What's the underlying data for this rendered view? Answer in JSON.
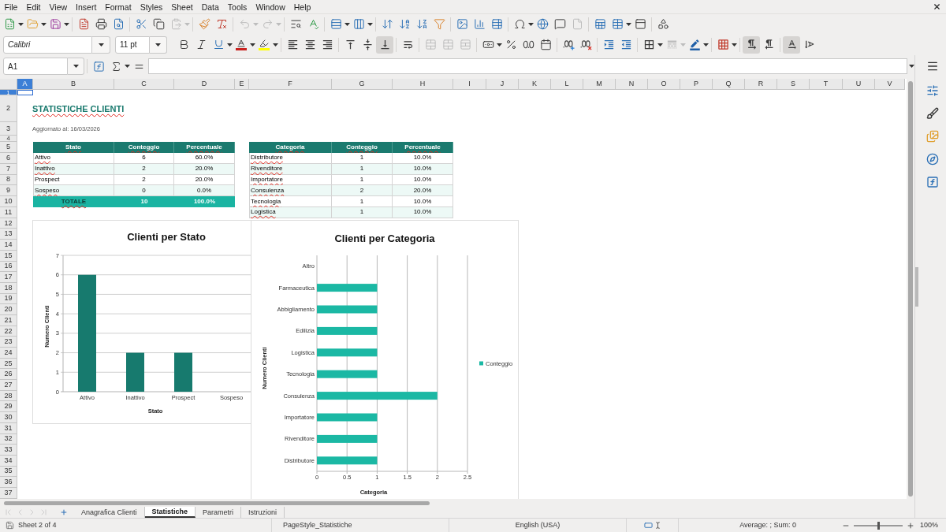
{
  "menu_bar": [
    "File",
    "Edit",
    "View",
    "Insert",
    "Format",
    "Styles",
    "Sheet",
    "Data",
    "Tools",
    "Window",
    "Help"
  ],
  "standard_toolbar": {
    "paste": {
      "disabled": true
    },
    "undo": {
      "disabled": true
    },
    "redo": {
      "disabled": true
    },
    "header_footer": {
      "disabled": true
    }
  },
  "format_toolbar": {
    "font_name": "Calibri",
    "font_size": "11 pt",
    "vertical_align": [
      {
        "selected": false
      },
      {
        "selected": false
      },
      {
        "selected": true
      }
    ],
    "merge_cells": [
      {
        "disabled": true
      },
      {
        "disabled": true
      },
      {
        "disabled": true
      }
    ],
    "border_style": {
      "disabled": true
    },
    "paragraph_direction": [
      {
        "selected": true
      },
      {
        "selected": false
      }
    ],
    "text_direction": [
      {
        "selected": true
      },
      {
        "selected": false
      }
    ]
  },
  "formula_bar": {
    "name_box": "A1"
  },
  "sheet": {
    "columns": [
      {
        "label": "A",
        "selected": true
      },
      {
        "label": "B",
        "selected": false
      },
      {
        "label": "C",
        "selected": false
      },
      {
        "label": "D",
        "selected": false
      },
      {
        "label": "E",
        "selected": false
      },
      {
        "label": "F",
        "selected": false
      },
      {
        "label": "G",
        "selected": false
      },
      {
        "label": "H",
        "selected": false
      },
      {
        "label": "I",
        "selected": false
      },
      {
        "label": "J",
        "selected": false
      },
      {
        "label": "K",
        "selected": false
      },
      {
        "label": "L",
        "selected": false
      },
      {
        "label": "M",
        "selected": false
      },
      {
        "label": "N",
        "selected": false
      },
      {
        "label": "O",
        "selected": false
      },
      {
        "label": "P",
        "selected": false
      },
      {
        "label": "Q",
        "selected": false
      },
      {
        "label": "R",
        "selected": false
      },
      {
        "label": "S",
        "selected": false
      },
      {
        "label": "T",
        "selected": false
      },
      {
        "label": "U",
        "selected": false
      },
      {
        "label": "V",
        "selected": false
      }
    ],
    "rows": [
      {
        "label": "1",
        "selected": true
      },
      {
        "label": "2",
        "selected": false
      },
      {
        "label": "3",
        "selected": false
      },
      {
        "label": "4",
        "selected": false
      },
      {
        "label": "5",
        "selected": false
      },
      {
        "label": "6",
        "selected": false
      },
      {
        "label": "7",
        "selected": false
      },
      {
        "label": "8",
        "selected": false
      },
      {
        "label": "9",
        "selected": false
      },
      {
        "label": "10",
        "selected": false
      },
      {
        "label": "11",
        "selected": false
      },
      {
        "label": "12",
        "selected": false
      },
      {
        "label": "13",
        "selected": false
      },
      {
        "label": "14",
        "selected": false
      },
      {
        "label": "15",
        "selected": false
      },
      {
        "label": "16",
        "selected": false
      },
      {
        "label": "17",
        "selected": false
      },
      {
        "label": "18",
        "selected": false
      },
      {
        "label": "19",
        "selected": false
      },
      {
        "label": "20",
        "selected": false
      },
      {
        "label": "21",
        "selected": false
      },
      {
        "label": "22",
        "selected": false
      },
      {
        "label": "23",
        "selected": false
      },
      {
        "label": "24",
        "selected": false
      },
      {
        "label": "25",
        "selected": false
      },
      {
        "label": "26",
        "selected": false
      },
      {
        "label": "27",
        "selected": false
      },
      {
        "label": "28",
        "selected": false
      },
      {
        "label": "29",
        "selected": false
      },
      {
        "label": "30",
        "selected": false
      },
      {
        "label": "31",
        "selected": false
      },
      {
        "label": "32",
        "selected": false
      },
      {
        "label": "33",
        "selected": false
      },
      {
        "label": "34",
        "selected": false
      },
      {
        "label": "35",
        "selected": false
      },
      {
        "label": "36",
        "selected": false
      },
      {
        "label": "37",
        "selected": false
      }
    ],
    "title": {
      "text": "STATISTICHE CLIENTI",
      "misspelled": true
    },
    "updated": {
      "text": "Aggiornato al: 16/03/2026"
    },
    "tables": [
      {
        "header": {
          "cells": [
            "Stato",
            "Conteggio",
            "Percentuale"
          ],
          "misspelled": true
        },
        "rows": [
          {
            "kind": "data",
            "label": "Attivo",
            "misspelled": true,
            "count": "6",
            "percent": "60.0%"
          },
          {
            "kind": "data",
            "label": "Inattivo",
            "misspelled": true,
            "count": "2",
            "percent": "20.0%"
          },
          {
            "kind": "data",
            "label": "Prospect",
            "misspelled": false,
            "count": "2",
            "percent": "20.0%"
          },
          {
            "kind": "data",
            "label": "Sospeso",
            "misspelled": true,
            "count": "0",
            "percent": "0.0%"
          },
          {
            "kind": "total",
            "label": "TOTALE",
            "misspelled": true,
            "count": "10",
            "percent": "100.0%"
          }
        ]
      },
      {
        "header": {
          "cells": [
            "Categoria",
            "Conteggio",
            "Percentuale"
          ],
          "misspelled": true
        },
        "rows": [
          {
            "kind": "data",
            "label": "Distributore",
            "misspelled": true,
            "count": "1",
            "percent": "10.0%"
          },
          {
            "kind": "data",
            "label": "Rivenditore",
            "misspelled": true,
            "count": "1",
            "percent": "10.0%"
          },
          {
            "kind": "data",
            "label": "Importatore",
            "misspelled": true,
            "count": "1",
            "percent": "10.0%"
          },
          {
            "kind": "data",
            "label": "Consulenza",
            "misspelled": true,
            "count": "2",
            "percent": "20.0%"
          },
          {
            "kind": "data",
            "label": "Tecnologia",
            "misspelled": true,
            "count": "1",
            "percent": "10.0%"
          },
          {
            "kind": "data",
            "label": "Logistica",
            "misspelled": true,
            "count": "1",
            "percent": "10.0%"
          }
        ]
      }
    ],
    "charts": [
      {
        "chart_data": {
          "type": "bar",
          "orientation": "vertical",
          "title": "Clienti per Stato",
          "xlabel": "Stato",
          "ylabel": "Numero Clienti",
          "categories": [
            "Attivo",
            "Inattivo",
            "Prospect",
            "Sospeso"
          ],
          "series": [
            {
              "color": "#177a6e",
              "values": [
                6,
                2,
                2,
                0
              ]
            }
          ],
          "ylim": [
            0,
            7
          ],
          "yticks": [
            0,
            1,
            2,
            3,
            4,
            5,
            6,
            7
          ],
          "grid": true
        }
      },
      {
        "chart_data": {
          "type": "bar",
          "orientation": "horizontal",
          "title": "Clienti per Categoria",
          "xlabel": "Categoria",
          "ylabel": "Numero Clienti",
          "categories": [
            "Altro",
            "Farmaceutica",
            "Abbigliamento",
            "Edilizia",
            "Logistica",
            "Tecnologia",
            "Consulenza",
            "Importatore",
            "Rivenditore",
            "Distributore"
          ],
          "series": [
            {
              "name": "Conteggio",
              "color": "#1bb8a4",
              "values": [
                0,
                1,
                1,
                1,
                1,
                1,
                2,
                1,
                1,
                1
              ]
            }
          ],
          "xlim": [
            0,
            2.5
          ],
          "xticks": [
            0,
            0.5,
            1,
            1.5,
            2,
            2.5
          ],
          "grid": true
        }
      }
    ]
  },
  "tab_bar": {
    "navigation": [
      {
        "disabled": true
      },
      {
        "disabled": true
      },
      {
        "disabled": true
      },
      {
        "disabled": true
      }
    ],
    "tabs": [
      {
        "label": "Anagrafica Clienti",
        "selected": false
      },
      {
        "label": "Statistiche",
        "selected": true
      },
      {
        "label": "Parametri",
        "selected": false
      },
      {
        "label": "Istruzioni",
        "selected": false
      }
    ]
  },
  "status_bar": {
    "sheet_position": "Sheet 2 of 4",
    "page_style": "PageStyle_Statistiche",
    "language": "English (USA)",
    "selection_summary": "Average: ; Sum: 0",
    "zoom_slider": {
      "level": 0.5
    },
    "zoom": "100%"
  }
}
